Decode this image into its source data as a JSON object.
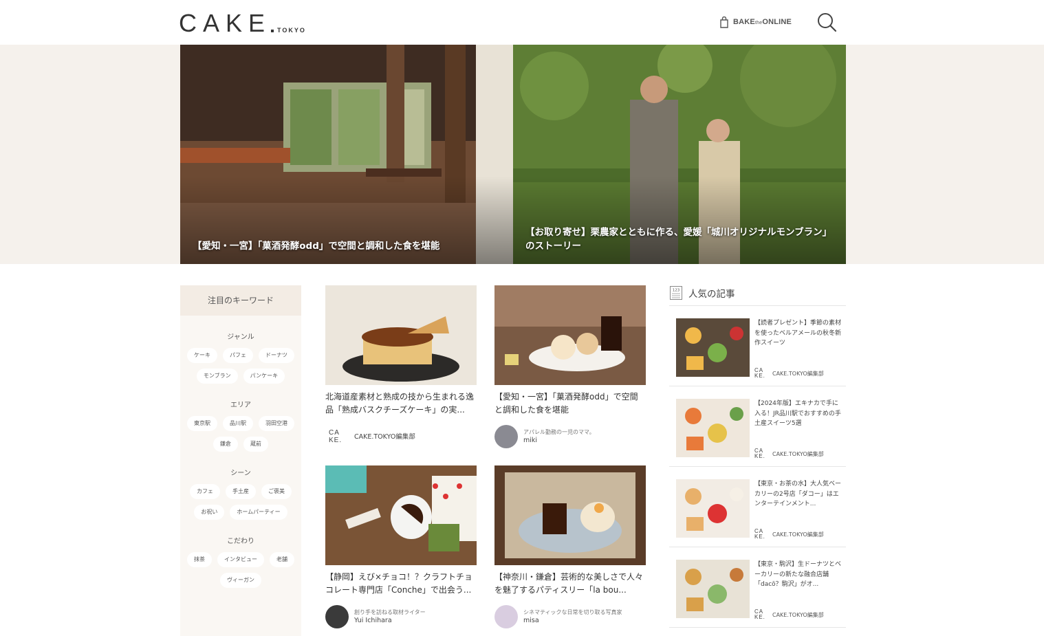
{
  "header": {
    "logo_main": "CAKE",
    "logo_sub": "TOKYO",
    "bake_brand": "BAKE",
    "bake_the": "the",
    "bake_online": "ONLINE"
  },
  "hero": [
    {
      "title": "【愛知・一宮】「菓酒発酵odd」で空間と調和した食を堪能"
    },
    {
      "title": "【お取り寄せ】栗農家とともに作る、愛媛「城川オリジナルモンブラン」のストーリー"
    }
  ],
  "sidebar": {
    "heading": "注目のキーワード",
    "groups": [
      {
        "title": "ジャンル",
        "tags": [
          "ケーキ",
          "パフェ",
          "ドーナツ",
          "モンブラン",
          "パンケーキ"
        ]
      },
      {
        "title": "エリア",
        "tags": [
          "東京駅",
          "品川駅",
          "羽田空港",
          "鎌倉",
          "蔵前"
        ]
      },
      {
        "title": "シーン",
        "tags": [
          "カフェ",
          "手土産",
          "ご褒美",
          "お祝い",
          "ホームパーティー"
        ]
      },
      {
        "title": "こだわり",
        "tags": [
          "抹茶",
          "インタビュー",
          "老舗",
          "ヴィーガン"
        ]
      }
    ]
  },
  "articles": [
    {
      "title": "北海道産素材と熟成の技から生まれる逸品「熟成バスクチーズケーキ」の実...",
      "role": "",
      "author": "CAKE.TOKYO編集部"
    },
    {
      "title": "【愛知・一宮】「菓酒発酵odd」で空間と調和した食を堪能",
      "role": "アパレル勤務の一児のママ。",
      "author": "miki"
    },
    {
      "title": "【静岡】えび×チョコ！？クラフトチョコレート専門店「Conche」で出会う...",
      "role": "創り手を訪ねる取材ライター",
      "author": "Yui Ichihara"
    },
    {
      "title": "【神奈川・鎌倉】芸術的な美しさで人々を魅了するパティスリー「la bou...",
      "role": "シネマティックな日常を切り取る写真家",
      "author": "misa"
    }
  ],
  "popular": {
    "heading": "人気の記事",
    "icon_label": "123",
    "logo_line1": "CA",
    "logo_line2": "KE.",
    "items": [
      {
        "title": "【読者プレゼント】季節の素材を使ったベルアメールの秋冬新作スイーツ",
        "author": "CAKE.TOKYO編集部"
      },
      {
        "title": "【2024年版】エキナカで手に入る！JR品川駅でおすすめの手土産スイーツ5選",
        "author": "CAKE.TOKYO編集部"
      },
      {
        "title": "【東京・お茶の水】大人気ベーカリーの2号店「ダコー」はエンターテインメント...",
        "author": "CAKE.TOKYO編集部"
      },
      {
        "title": "【東京・駒沢】生ドーナツとベーカリーの新たな融合店舗「dacō？駒沢」がオ...",
        "author": "CAKE.TOKYO編集部"
      }
    ]
  },
  "colors": {
    "sidebar_bg": "#faf7f3",
    "sidebar_head_bg": "#f3ece4",
    "hero_band": "#f5f1ec"
  }
}
